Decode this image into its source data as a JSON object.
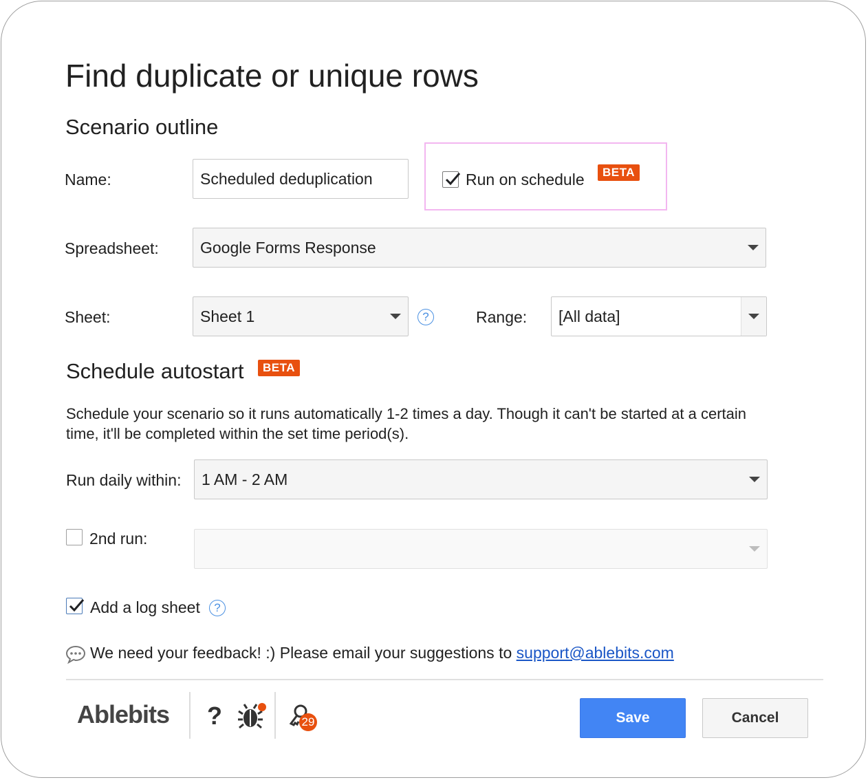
{
  "dialog": {
    "title": "Find duplicate or unique rows"
  },
  "scenario": {
    "heading": "Scenario outline",
    "name_label": "Name:",
    "name_value": "Scheduled deduplication",
    "run_on_schedule_label": "Run on schedule",
    "run_on_schedule_checked": true,
    "beta_badge": "BETA",
    "spreadsheet_label": "Spreadsheet:",
    "spreadsheet_value": "Google Forms Response",
    "sheet_label": "Sheet:",
    "sheet_value": "Sheet 1",
    "range_label": "Range:",
    "range_value": "[All data]"
  },
  "schedule": {
    "heading": "Schedule autostart",
    "beta_badge": "BETA",
    "description": "Schedule your scenario so it runs automatically 1-2 times a day. Though it can't be started at a certain time, it'll be completed within the set time period(s).",
    "run_daily_label": "Run daily within:",
    "run_daily_value": "1 AM - 2 AM",
    "second_run_label": "2nd run:",
    "second_run_checked": false,
    "second_run_value": "",
    "log_sheet_label": "Add a log sheet",
    "log_sheet_checked": true
  },
  "feedback": {
    "text": "We need your feedback! :) Please email your suggestions to",
    "email": "support@ablebits.com"
  },
  "footer": {
    "logo": "Ablebits",
    "help_glyph": "?",
    "notification_count": "29",
    "save_label": "Save",
    "cancel_label": "Cancel"
  },
  "colors": {
    "accent": "#4285f4",
    "beta": "#e8500f",
    "highlight": "#f3b6f0",
    "link": "#1a56c6"
  }
}
